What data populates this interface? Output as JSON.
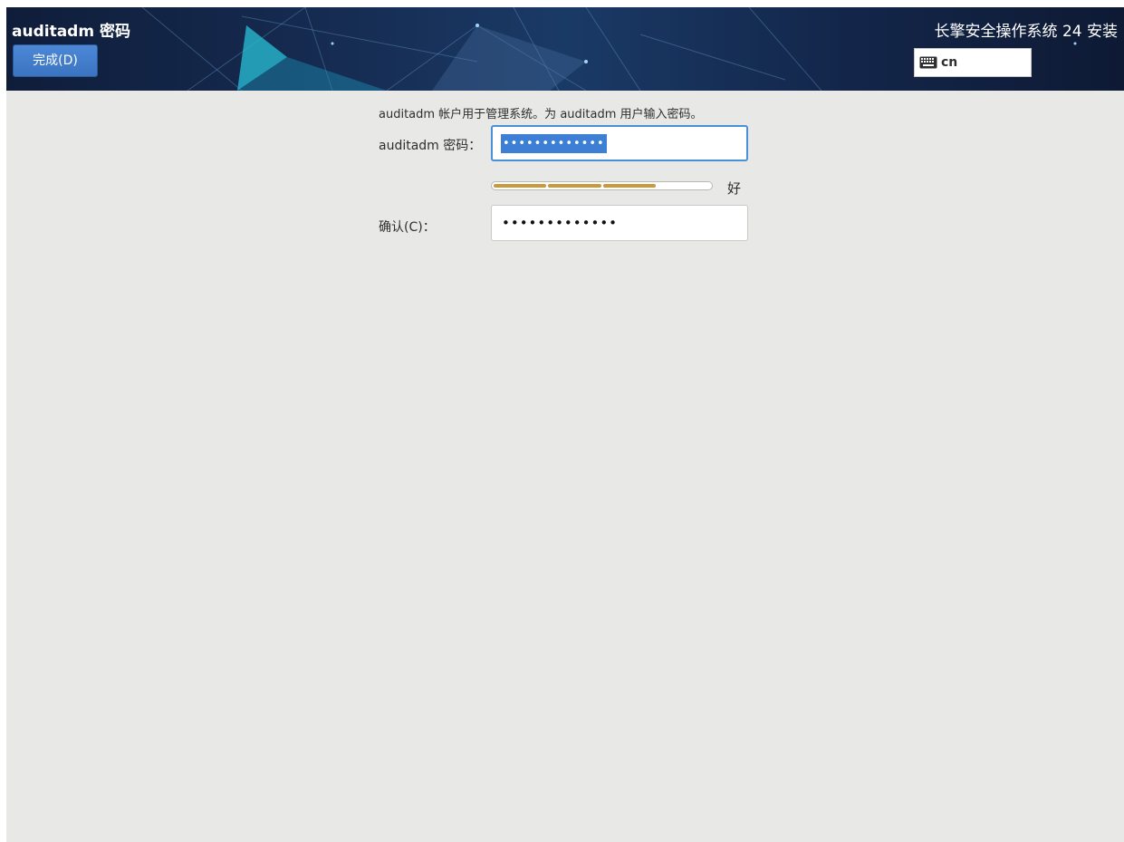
{
  "header": {
    "spoke_title": "auditadm 密码",
    "done_label": "完成(D)",
    "product_title": "长擎安全操作系统 24 安装",
    "keyboard_layout": "cn",
    "keyboard_icon": "keyboard-icon"
  },
  "form": {
    "intro": "auditadm 帐户用于管理系统。为 auditadm 用户输入密码。",
    "password_label": "auditadm 密码：",
    "password_value": "•••••••••••••",
    "password_strength_level": 0.75,
    "password_strength_text": "好",
    "confirm_label": "确认(C)：",
    "confirm_value": "•••••••••••••"
  },
  "colors": {
    "accent": "#4a90d9",
    "button": "#3b74c1",
    "strength_bar": "#c89a3c",
    "background": "#e8e8e7"
  }
}
